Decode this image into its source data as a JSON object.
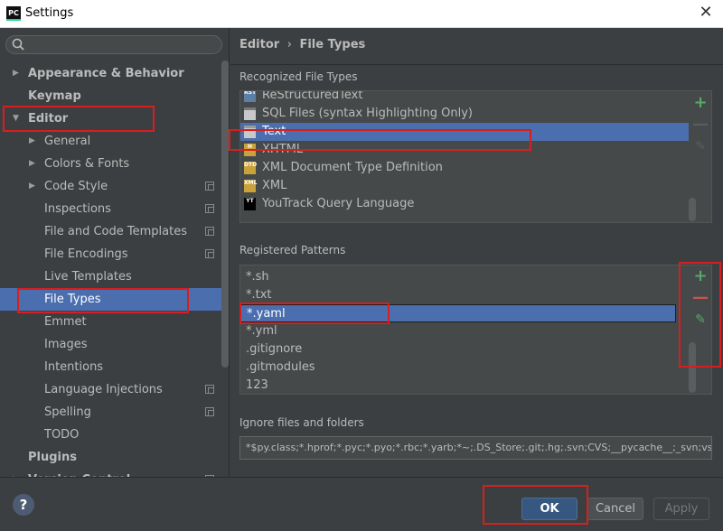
{
  "window": {
    "app_icon_text": "PC",
    "title": "Settings",
    "close_glyph": "✕"
  },
  "search": {
    "placeholder": "",
    "icon": "search-icon"
  },
  "tree": [
    {
      "label": "Appearance & Behavior",
      "level": 0,
      "arrow": "right",
      "bold": true
    },
    {
      "label": "Keymap",
      "level": 0,
      "arrow": "",
      "bold": true
    },
    {
      "label": "Editor",
      "level": 0,
      "arrow": "down",
      "bold": true
    },
    {
      "label": "General",
      "level": 1,
      "arrow": "right"
    },
    {
      "label": "Colors & Fonts",
      "level": 1,
      "arrow": "right"
    },
    {
      "label": "Code Style",
      "level": 1,
      "arrow": "right",
      "copy": true
    },
    {
      "label": "Inspections",
      "level": 1,
      "arrow": "",
      "copy": true
    },
    {
      "label": "File and Code Templates",
      "level": 1,
      "arrow": "",
      "copy": true
    },
    {
      "label": "File Encodings",
      "level": 1,
      "arrow": "",
      "copy": true
    },
    {
      "label": "Live Templates",
      "level": 1,
      "arrow": ""
    },
    {
      "label": "File Types",
      "level": 1,
      "arrow": "",
      "selected": true
    },
    {
      "label": "Emmet",
      "level": 1,
      "arrow": ""
    },
    {
      "label": "Images",
      "level": 1,
      "arrow": ""
    },
    {
      "label": "Intentions",
      "level": 1,
      "arrow": ""
    },
    {
      "label": "Language Injections",
      "level": 1,
      "arrow": "",
      "copy": true
    },
    {
      "label": "Spelling",
      "level": 1,
      "arrow": "",
      "copy": true
    },
    {
      "label": "TODO",
      "level": 1,
      "arrow": ""
    },
    {
      "label": "Plugins",
      "level": 0,
      "arrow": "",
      "bold": true
    },
    {
      "label": "Version Control",
      "level": 0,
      "arrow": "right",
      "bold": true,
      "copy": true
    }
  ],
  "breadcrumb": {
    "parent": "Editor",
    "separator": "›",
    "current": "File Types"
  },
  "recognized": {
    "label": "Recognized File Types",
    "items": [
      {
        "name": "ReStructuredText",
        "icon": "rst-file-icon",
        "icon_text": "RST",
        "icon_color": "#5b7fa6"
      },
      {
        "name": "SQL Files (syntax Highlighting Only)",
        "icon": "sql-file-icon",
        "icon_text": "",
        "icon_color": "#8a8a8a"
      },
      {
        "name": "Text",
        "icon": "text-file-icon",
        "icon_text": "",
        "icon_color": "#9a9a9a",
        "selected": true
      },
      {
        "name": "XHTML",
        "icon": "xhtml-file-icon",
        "icon_text": "H",
        "icon_color": "#c9a23a"
      },
      {
        "name": "XML Document Type Definition",
        "icon": "dtd-file-icon",
        "icon_text": "DTD",
        "icon_color": "#c9a23a"
      },
      {
        "name": "XML",
        "icon": "xml-file-icon",
        "icon_text": "XML",
        "icon_color": "#c9a23a"
      },
      {
        "name": "YouTrack Query Language",
        "icon": "youtrack-icon",
        "icon_text": "YT",
        "icon_color": "#000000"
      }
    ]
  },
  "patterns": {
    "label": "Registered Patterns",
    "items": [
      {
        "name": "*.sh"
      },
      {
        "name": "*.txt"
      },
      {
        "name": "*.yaml",
        "selected": true
      },
      {
        "name": "*.yml"
      },
      {
        "name": ".gitignore"
      },
      {
        "name": ".gitmodules"
      },
      {
        "name": "123"
      }
    ]
  },
  "tools": {
    "add": "+",
    "remove": "—",
    "edit": "✎"
  },
  "ignore": {
    "label": "Ignore files and folders",
    "value": "*$py.class;*.hprof;*.pyc;*.pyo;*.rbc;*.yarb;*~;.DS_Store;.git;.hg;.svn;CVS;__pycache__;_svn;vss"
  },
  "footer": {
    "help": "?",
    "ok": "OK",
    "cancel": "Cancel",
    "apply": "Apply"
  },
  "colors": {
    "selection": "#4b6eaf",
    "annotation": "#d81e1e",
    "add": "#59a869",
    "remove": "#c75450"
  }
}
